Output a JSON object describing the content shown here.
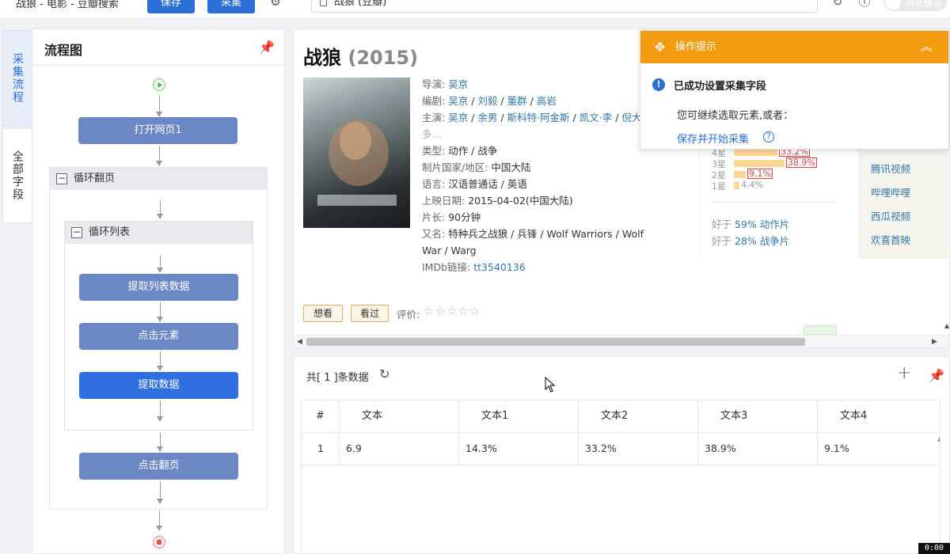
{
  "topbar": {
    "task_title": "战狼 - 电影 - 豆瓣搜索",
    "save_label": "保存",
    "collect_label": "采集",
    "address": "战狼 (豆瓣)",
    "browse_mode_label": "浏览模式"
  },
  "side_tabs": {
    "workflow": "采集流程",
    "all_fields": "全部字段"
  },
  "flow": {
    "title": "流程图",
    "open_page": "打开网页1",
    "loop_page": "循环翻页",
    "loop_list": "循环列表",
    "extract_list": "提取列表数据",
    "click_element": "点击元素",
    "extract_data": "提取数据",
    "click_next": "点击翻页"
  },
  "movie": {
    "title": "战狼",
    "year": "(2015)",
    "director_label": "导演:",
    "director": "吴京",
    "writers_label": "编剧:",
    "writers": [
      "吴京",
      "刘毅",
      "董群",
      "高岩"
    ],
    "cast_label": "主演:",
    "cast": [
      "吴京",
      "余男",
      "斯科特·阿金斯",
      "凯文·李",
      "倪大"
    ],
    "more": "多...",
    "genre_label": "类型:",
    "genre": "动作 / 战争",
    "country_label": "制片国家/地区:",
    "country": "中国大陆",
    "language_label": "语言:",
    "language": "汉语普通话 / 英语",
    "release_label": "上映日期:",
    "release": "2015-04-02(中国大陆)",
    "runtime_label": "片长:",
    "runtime": "90分钟",
    "aka_label": "又名:",
    "aka": "特种兵之战狼 / 兵锋 / Wolf Warriors / Wolf War / Warg",
    "imdb_label": "IMDb链接:",
    "imdb": "tt3540136",
    "want_label": "想看",
    "seen_label": "看过",
    "rate_label": "评价:"
  },
  "ratings": [
    {
      "star": "4星",
      "pct": "33.2%",
      "value": 33.2,
      "highlight": true
    },
    {
      "star": "3星",
      "pct": "38.9%",
      "value": 38.9,
      "highlight": true
    },
    {
      "star": "2星",
      "pct": "9.1%",
      "value": 9.1,
      "highlight": true
    },
    {
      "star": "1星",
      "pct": "4.4%",
      "value": 4.4,
      "highlight": false
    }
  ],
  "better_than": {
    "line1_prefix": "好于",
    "line1_link": "59% 动作片",
    "line2_prefix": "好于",
    "line2_link": "28% 战争片"
  },
  "platforms": [
    "腾讯视频",
    "哔哩哔哩",
    "西瓜视频",
    "欢喜首映"
  ],
  "tip": {
    "header": "操作提示",
    "success": "已成功设置采集字段",
    "desc": "您可继续选取元素,或者：",
    "action": "保存并开始采集"
  },
  "data_panel": {
    "count_text": "共[ 1 ]条数据",
    "columns": [
      "#",
      "文本",
      "文本1",
      "文本2",
      "文本3",
      "文本4"
    ],
    "rows": [
      [
        "1",
        "6.9",
        "14.3%",
        "33.2%",
        "38.9%",
        "9.1%"
      ]
    ]
  },
  "timer": "0:00",
  "colors": {
    "primary": "#2b6fd6",
    "node": "#6b87c4",
    "tip_orange": "#f39c12",
    "link": "#3377aa"
  }
}
